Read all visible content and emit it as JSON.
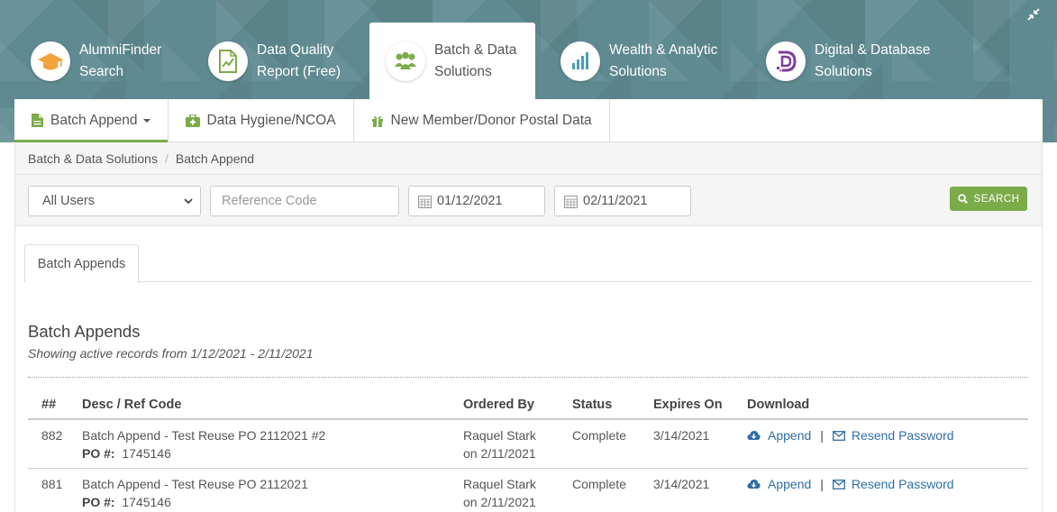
{
  "main_tabs": [
    {
      "line1": "AlumniFinder",
      "line2": "Search",
      "icon": "graduation-cap-icon",
      "color": "#f2a33a"
    },
    {
      "line1": "Data Quality",
      "line2": "Report (Free)",
      "icon": "report-chart-icon",
      "color": "#7cab4a"
    },
    {
      "line1": "Batch & Data",
      "line2": "Solutions",
      "icon": "people-group-icon",
      "color": "#7cab4a"
    },
    {
      "line1": "Wealth & Analytic",
      "line2": "Solutions",
      "icon": "bar-chart-icon",
      "color": "#4a9fb5"
    },
    {
      "line1": "Digital & Database",
      "line2": "Solutions",
      "icon": "digital-d-icon",
      "color": "#7b3fa0"
    }
  ],
  "sub_tabs": {
    "batch_append": "Batch Append",
    "data_hygiene": "Data Hygiene/NCOA",
    "new_member": "New Member/Donor Postal Data"
  },
  "breadcrumb": {
    "root": "Batch & Data Solutions",
    "current": "Batch Append"
  },
  "filters": {
    "user_select": "All Users",
    "reference_placeholder": "Reference Code",
    "date_from": "01/12/2021",
    "date_to": "02/11/2021",
    "search_label": "SEARCH"
  },
  "inner_tab": "Batch Appends",
  "section": {
    "title": "Batch Appends",
    "subtitle": "Showing active records from 1/12/2021 - 2/11/2021"
  },
  "table": {
    "headers": [
      "##",
      "Desc / Ref Code",
      "Ordered By",
      "Status",
      "Expires On",
      "Download"
    ],
    "po_label": "PO #:",
    "rows": [
      {
        "num": "882",
        "desc": "Batch Append - Test Reuse PO 2112021 #2",
        "po": "1745146",
        "ordered_by": "Raquel Stark",
        "ordered_on": "on 2/11/2021",
        "status": "Complete",
        "expires": "3/14/2021",
        "append": "Append",
        "resend": "Resend Password"
      },
      {
        "num": "881",
        "desc": "Batch Append - Test Reuse PO 2112021",
        "po": "1745146",
        "ordered_by": "Raquel Stark",
        "ordered_on": "on 2/11/2021",
        "status": "Complete",
        "expires": "3/14/2021",
        "append": "Append",
        "resend": "Resend Password"
      }
    ],
    "separator": "|"
  },
  "colors": {
    "accent_green": "#7cab4a",
    "link_blue": "#2f6ea5",
    "banner": "#5f8a92"
  }
}
